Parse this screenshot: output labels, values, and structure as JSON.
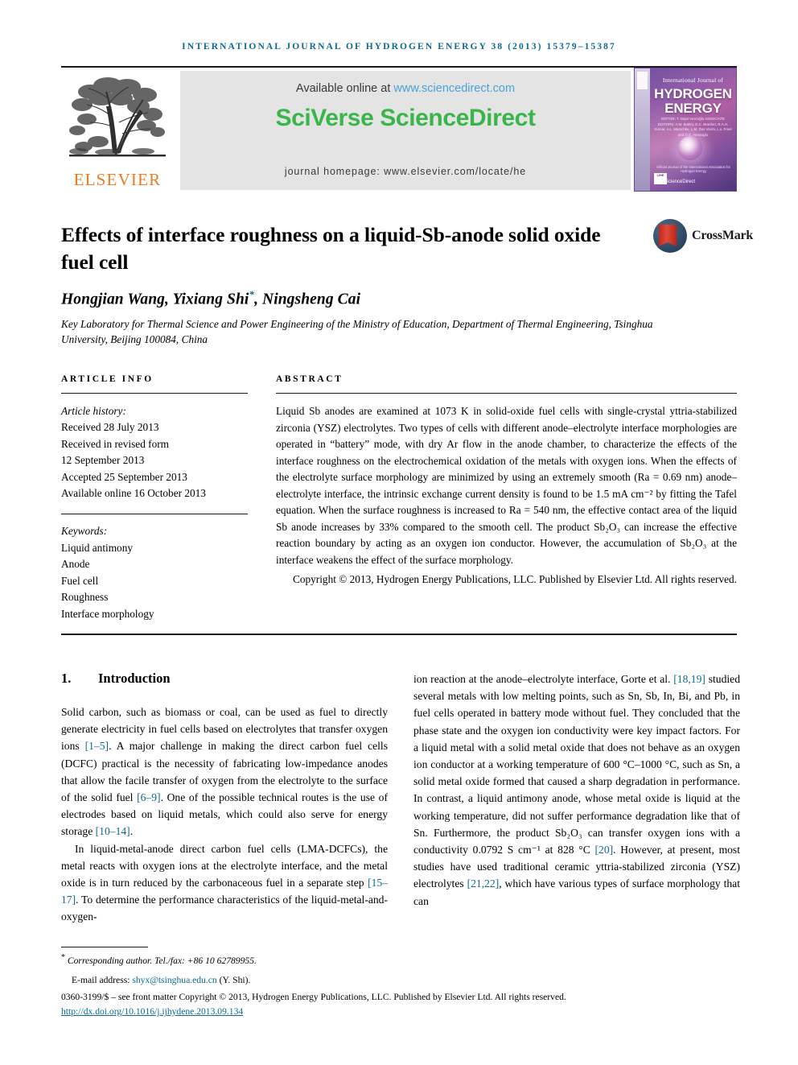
{
  "running_head": "International Journal of Hydrogen Energy 38 (2013) 15379–15387",
  "masthead": {
    "publisher_name": "ELSEVIER",
    "available_prefix": "Available online at ",
    "available_url": "www.sciencedirect.com",
    "wordmark": "SciVerse ScienceDirect",
    "homepage": "journal homepage: www.elsevier.com/locate/he",
    "cover": {
      "top_line": "International Journal of",
      "line_hydrogen": "HYDROGEN",
      "line_energy": "ENERGY",
      "editors": "EDITOR: T. Nejat Veziroğlu   ASSOCIATE EDITORS: A.M. Bottini, D.C. Branfort, R.A.H. Kumar, A.L. Marschke, L.M. Das Vieira, L.s. Freel and D.C. Amraoglu",
      "bottom_note": "Official Journal of the International Association for Hydrogen Energy",
      "sciencedirect": "ScienceDirect",
      "badge": "IJHE"
    }
  },
  "title": "Effects of interface roughness on a liquid-Sb-anode solid oxide fuel cell",
  "crossmark_label": "CrossMark",
  "authors": {
    "names": "Hongjian Wang, Yixiang Shi",
    "corresponding_marker": "*",
    "names_tail": ", Ningsheng Cai",
    "affiliation": "Key Laboratory for Thermal Science and Power Engineering of the Ministry of Education, Department of Thermal Engineering, Tsinghua University, Beijing 100084, China"
  },
  "article_info": {
    "label": "Article info",
    "history_label": "Article history:",
    "history": [
      "Received 28 July 2013",
      "Received in revised form",
      "12 September 2013",
      "Accepted 25 September 2013",
      "Available online 16 October 2013"
    ],
    "keywords_label": "Keywords:",
    "keywords": [
      "Liquid antimony",
      "Anode",
      "Fuel cell",
      "Roughness",
      "Interface morphology"
    ]
  },
  "abstract": {
    "label": "Abstract",
    "body": "Liquid Sb anodes are examined at 1073 K in solid-oxide fuel cells with single-crystal yttria-stabilized zirconia (YSZ) electrolytes. Two types of cells with different anode–electrolyte interface morphologies are operated in “battery” mode, with dry Ar flow in the anode chamber, to characterize the effects of the interface roughness on the electrochemical oxidation of the metals with oxygen ions. When the effects of the electrolyte surface morphology are minimized by using an extremely smooth (Ra = 0.69 nm) anode–electrolyte interface, the intrinsic exchange current density is found to be 1.5 mA cm⁻² by fitting the Tafel equation. When the surface roughness is increased to Ra = 540 nm, the effective contact area of the liquid Sb anode increases by 33% compared to the smooth cell. The product Sb₂O₃ can increase the effective reaction boundary by acting as an oxygen ion conductor. However, the accumulation of Sb₂O₃ at the interface weakens the effect of the surface morphology.",
    "copyright": "Copyright © 2013, Hydrogen Energy Publications, LLC. Published by Elsevier Ltd. All rights reserved."
  },
  "introduction": {
    "number": "1.",
    "heading": "Introduction",
    "left_paragraphs": [
      {
        "indent": false,
        "segments": [
          {
            "t": "Solid carbon, such as biomass or coal, can be used as fuel to directly generate electricity in fuel cells based on electrolytes that transfer oxygen ions "
          },
          {
            "t": "[1–5]",
            "ref": true
          },
          {
            "t": ". A major challenge in making the direct carbon fuel cells (DCFC) practical is the necessity of fabricating low-impedance anodes that allow the facile transfer of oxygen from the electrolyte to the surface of the solid fuel "
          },
          {
            "t": "[6–9]",
            "ref": true
          },
          {
            "t": ". One of the possible technical routes is the use of electrodes based on liquid metals, which could also serve for energy storage "
          },
          {
            "t": "[10–14]",
            "ref": true
          },
          {
            "t": "."
          }
        ]
      },
      {
        "indent": true,
        "segments": [
          {
            "t": "In liquid-metal-anode direct carbon fuel cells (LMA-DCFCs), the metal reacts with oxygen ions at the electrolyte interface, and the metal oxide is in turn reduced by the carbonaceous fuel in a separate step "
          },
          {
            "t": "[15–17]",
            "ref": true
          },
          {
            "t": ". To determine the performance characteristics of the liquid-metal-and-oxygen-"
          }
        ]
      }
    ],
    "right_paragraphs": [
      {
        "indent": false,
        "segments": [
          {
            "t": "ion reaction at the anode–electrolyte interface, Gorte et al. "
          },
          {
            "t": "[18,19]",
            "ref": true
          },
          {
            "t": " studied several metals with low melting points, such as Sn, Sb, In, Bi, and Pb, in fuel cells operated in battery mode without fuel. They concluded that the phase state and the oxygen ion conductivity were key impact factors. For a liquid metal with a solid metal oxide that does not behave as an oxygen ion conductor at a working temperature of 600 °C–1000 °C, such as Sn, a solid metal oxide formed that caused a sharp degradation in performance. In contrast, a liquid antimony anode, whose metal oxide is liquid at the working temperature, did not suffer performance degradation like that of Sn. Furthermore, the product Sb₂O₃ can transfer oxygen ions with a conductivity 0.0792 S cm⁻¹ at 828 °C "
          },
          {
            "t": "[20]",
            "ref": true
          },
          {
            "t": ". However, at present, most studies have used traditional ceramic yttria-stabilized zirconia (YSZ) electrolytes "
          },
          {
            "t": "[21,22]",
            "ref": true
          },
          {
            "t": ", which have various types of surface morphology that can"
          }
        ]
      }
    ]
  },
  "footnote": {
    "corresponding": "Corresponding author. Tel./fax: +86 10 62789955.",
    "email_label": "E-mail address: ",
    "email": "shyx@tsinghua.edu.cn",
    "email_suffix": " (Y. Shi).",
    "issn_line": "0360-3199/$ – see front matter Copyright © 2013, Hydrogen Energy Publications, LLC. Published by Elsevier Ltd. All rights reserved.",
    "doi": "http://dx.doi.org/10.1016/j.ijhydene.2013.09.134"
  },
  "colors": {
    "journal_teal": "#0b6a91",
    "sciencedirect_green": "#3ab54a",
    "elsevier_orange": "#eb7c20",
    "link_blue": "#4aa3d8",
    "banner_gray": "#e4e4e4"
  }
}
